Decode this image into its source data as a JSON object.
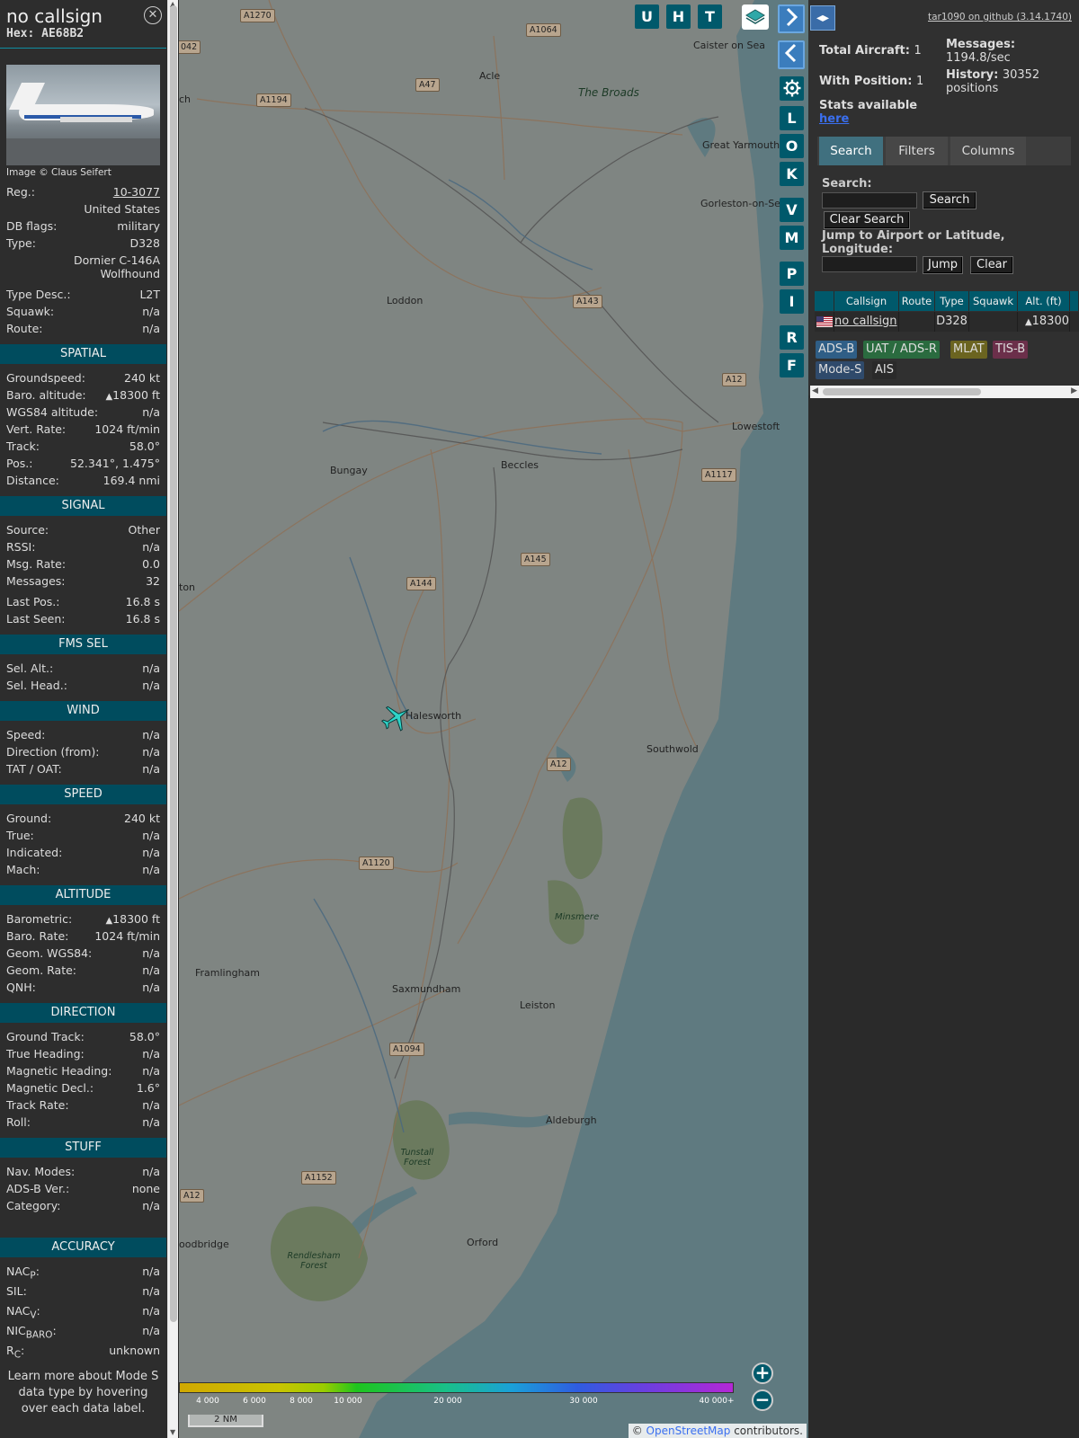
{
  "info": {
    "callsign": "no callsign",
    "hex": "Hex: AE68B2",
    "image_credit": "Image © Claus Seifert",
    "reg_label": "Reg.:",
    "reg_value": "10-3077",
    "country": "United States",
    "dbflags_label": "DB flags:",
    "dbflags_value": "military",
    "type_label": "Type:",
    "type_value": "D328",
    "type_name": "Dornier C-146A Wolfhound",
    "typedesc_label": "Type Desc.:",
    "typedesc_value": "L2T",
    "squawk_label": "Squawk:",
    "squawk_value": "n/a",
    "route_label": "Route:",
    "route_value": "n/a"
  },
  "spatial": {
    "title": "SPATIAL",
    "groundspeed_label": "Groundspeed:",
    "groundspeed_value": "240 kt",
    "baro_label": "Baro. altitude:",
    "baro_value": "18300 ft",
    "wgs_label": "WGS84 altitude:",
    "wgs_value": "n/a",
    "vrate_label": "Vert. Rate:",
    "vrate_value": "1024 ft/min",
    "track_label": "Track:",
    "track_value": "58.0°",
    "pos_label": "Pos.:",
    "pos_value": "52.341°, 1.475°",
    "dist_label": "Distance:",
    "dist_value": "169.4 nmi"
  },
  "signal": {
    "title": "SIGNAL",
    "source_label": "Source:",
    "source_value": "Other",
    "rssi_label": "RSSI:",
    "rssi_value": "n/a",
    "msgrate_label": "Msg. Rate:",
    "msgrate_value": "0.0",
    "messages_label": "Messages:",
    "messages_value": "32",
    "lastpos_label": "Last Pos.:",
    "lastpos_value": "16.8 s",
    "lastseen_label": "Last Seen:",
    "lastseen_value": "16.8 s"
  },
  "fms": {
    "title": "FMS SEL",
    "selalt_label": "Sel. Alt.:",
    "selalt_value": "n/a",
    "selhead_label": "Sel. Head.:",
    "selhead_value": "n/a"
  },
  "wind": {
    "title": "WIND",
    "speed_label": "Speed:",
    "speed_value": "n/a",
    "dir_label": "Direction (from):",
    "dir_value": "n/a",
    "tat_label": "TAT / OAT:",
    "tat_value": "n/a"
  },
  "speed": {
    "title": "SPEED",
    "ground_label": "Ground:",
    "ground_value": "240 kt",
    "true_label": "True:",
    "true_value": "n/a",
    "ind_label": "Indicated:",
    "ind_value": "n/a",
    "mach_label": "Mach:",
    "mach_value": "n/a"
  },
  "altitude": {
    "title": "ALTITUDE",
    "baro_label": "Barometric:",
    "baro_value": "18300 ft",
    "barorate_label": "Baro. Rate:",
    "barorate_value": "1024 ft/min",
    "geom_label": "Geom. WGS84:",
    "geom_value": "n/a",
    "geomrate_label": "Geom. Rate:",
    "geomrate_value": "n/a",
    "qnh_label": "QNH:",
    "qnh_value": "n/a"
  },
  "direction": {
    "title": "DIRECTION",
    "gtrack_label": "Ground Track:",
    "gtrack_value": "58.0°",
    "thead_label": "True Heading:",
    "thead_value": "n/a",
    "mhead_label": "Magnetic Heading:",
    "mhead_value": "n/a",
    "mdecl_label": "Magnetic Decl.:",
    "mdecl_value": "1.6°",
    "trate_label": "Track Rate:",
    "trate_value": "n/a",
    "roll_label": "Roll:",
    "roll_value": "n/a"
  },
  "stuff": {
    "title": "STUFF",
    "nav_label": "Nav. Modes:",
    "nav_value": "n/a",
    "adsb_label": "ADS-B Ver.:",
    "adsb_value": "none",
    "cat_label": "Category:",
    "cat_value": "n/a"
  },
  "accuracy": {
    "title": "ACCURACY",
    "nacp_label": "NAC",
    "nacp_sub": "P",
    "nacp_value": "n/a",
    "sil_label": "SIL:",
    "sil_value": "n/a",
    "nacv_label": "NAC",
    "nacv_sub": "V",
    "nacv_value": "n/a",
    "nic_label": "NIC",
    "nic_sub": "BARO",
    "nic_value": "n/a",
    "rc_label": "R",
    "rc_sub": "C",
    "rc_value": "unknown"
  },
  "footer_text": "Learn more about Mode S data type by hovering over each data label.",
  "map": {
    "buttons_top": [
      "U",
      "H",
      "T"
    ],
    "buttons_side": [
      "L",
      "O",
      "K",
      "V",
      "M",
      "P",
      "I",
      "R",
      "F"
    ],
    "zoom_in": "+",
    "zoom_out": "−",
    "scale": "2 NM",
    "attribution_prefix": "© ",
    "attribution_link": "OpenStreetMap",
    "attribution_suffix": " contributors.",
    "legend_ticks": [
      "4 000",
      "6 000",
      "8 000",
      "10 000",
      "20 000",
      "30 000",
      "40 000+"
    ],
    "places": [
      {
        "name": "The Broads",
        "style": "italic"
      },
      {
        "name": "Caister on Sea",
        "style": "town"
      },
      {
        "name": "Acle",
        "style": "town"
      },
      {
        "name": "Great Yarmouth",
        "style": "town"
      },
      {
        "name": "Gorleston-on-Sea",
        "style": "town"
      },
      {
        "name": "Loddon",
        "style": "town"
      },
      {
        "name": "Lowestoft",
        "style": "town"
      },
      {
        "name": "Bungay",
        "style": "town"
      },
      {
        "name": "Beccles",
        "style": "town"
      },
      {
        "name": "Halesworth",
        "style": "town"
      },
      {
        "name": "Southwold",
        "style": "town"
      },
      {
        "name": "Minsmere",
        "style": "italic"
      },
      {
        "name": "Framlingham",
        "style": "town"
      },
      {
        "name": "Saxmundham",
        "style": "town"
      },
      {
        "name": "Leiston",
        "style": "town"
      },
      {
        "name": "Aldeburgh",
        "style": "town"
      },
      {
        "name": "Tunstall Forest",
        "style": "italic"
      },
      {
        "name": "Orford",
        "style": "town"
      },
      {
        "name": "Rendlesham Forest",
        "style": "italic"
      },
      {
        "name": "oodbridge",
        "style": "town"
      },
      {
        "name": "ch",
        "style": "town"
      },
      {
        "name": "ton",
        "style": "town"
      }
    ],
    "roads": [
      "A1270",
      "A1064",
      "A47",
      "A1194",
      "042",
      "A143",
      "A12",
      "A1117",
      "A145",
      "A144",
      "A12",
      "A1120",
      "A1094",
      "A1152",
      "A12"
    ]
  },
  "right": {
    "toggle": "◂▸",
    "github": "tar1090 on github (3.14.1740)",
    "total_label": "Total Aircraft:",
    "total_value": "1",
    "withpos_label": "With Position:",
    "withpos_value": "1",
    "messages_label": "Messages:",
    "messages_value": "1194.8/sec",
    "history_label": "History:",
    "history_value": "30352 positions",
    "stats_text": "Stats available",
    "stats_link": "here",
    "tabs": [
      "Search",
      "Filters",
      "Columns"
    ],
    "search_label": "Search:",
    "search_button": "Search",
    "clear_search_button": "Clear Search",
    "jump_label": "Jump to Airport or Latitude, Longitude:",
    "jump_button": "Jump",
    "clear_button": "Clear",
    "table_headers": [
      "",
      "Callsign",
      "Route",
      "Type",
      "Squawk",
      "Alt. (ft)"
    ],
    "row": {
      "callsign": "no callsign",
      "route": "",
      "type": "D328",
      "squawk": "",
      "alt": "18300"
    },
    "badges": [
      {
        "label": "ADS-B",
        "color": "#2f5e86"
      },
      {
        "label": "UAT / ADS-R",
        "color": "#2a6b3f"
      },
      {
        "label": "MLAT",
        "color": "#6b6420"
      },
      {
        "label": "TIS-B",
        "color": "#6b2f4a"
      },
      {
        "label": "Mode-S",
        "color": "#2f4a6b"
      },
      {
        "label": "AIS",
        "color": "#2a2a2a"
      }
    ]
  },
  "colors": {
    "accent": "#00596b",
    "section": "#004c5e",
    "aircraft": "#2fd4c8"
  }
}
